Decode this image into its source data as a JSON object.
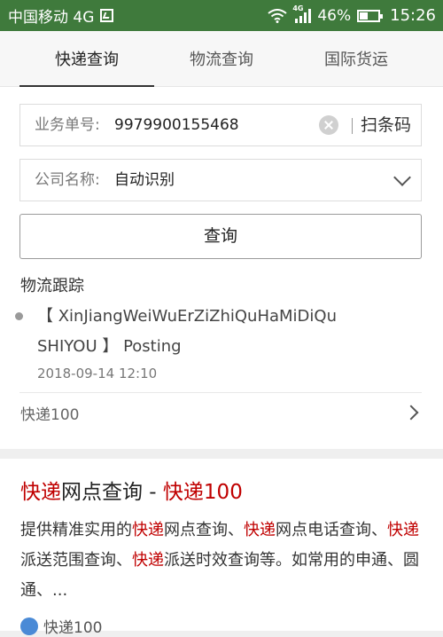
{
  "status_bar": {
    "carrier": "中国移动 4G",
    "network_tag": "4G",
    "battery": "46%",
    "battery_level": 0.46,
    "time": "15:26"
  },
  "tabs": [
    "快递查询",
    "物流查询",
    "国际货运"
  ],
  "form": {
    "number_label": "业务单号:",
    "number_value": "9979900155468",
    "scan_label": "扫条码",
    "company_label": "公司名称:",
    "company_value": "自动识别",
    "query_button": "查询"
  },
  "tracking": {
    "title": "物流跟踪",
    "entry_text": "【 XinJiangWeiWuErZiZhiQuHaMiDiQu SHIYOU 】 Posting",
    "entry_time": "2018-09-14 12:10",
    "source_link": "快递100"
  },
  "result": {
    "title_red1": "快递",
    "title_mid": "网点查询 - ",
    "title_red2": "快递",
    "title_end": "100",
    "desc_parts": [
      {
        "text": "提供精准实用的",
        "red": false
      },
      {
        "text": "快递",
        "red": true
      },
      {
        "text": "网点查询、",
        "red": false
      },
      {
        "text": "快递",
        "red": true
      },
      {
        "text": "网点电话查询、",
        "red": false
      },
      {
        "text": "快递",
        "red": true
      },
      {
        "text": "派送范围查询、",
        "red": false
      },
      {
        "text": "快递",
        "red": true
      },
      {
        "text": "派送时效查询等。如常用的申通、圆通、...",
        "red": false
      }
    ],
    "source": "快递100"
  },
  "colors": {
    "status_bar": "#3f7a3c",
    "highlight_red": "#c00000",
    "page_bg": "#efefef"
  }
}
